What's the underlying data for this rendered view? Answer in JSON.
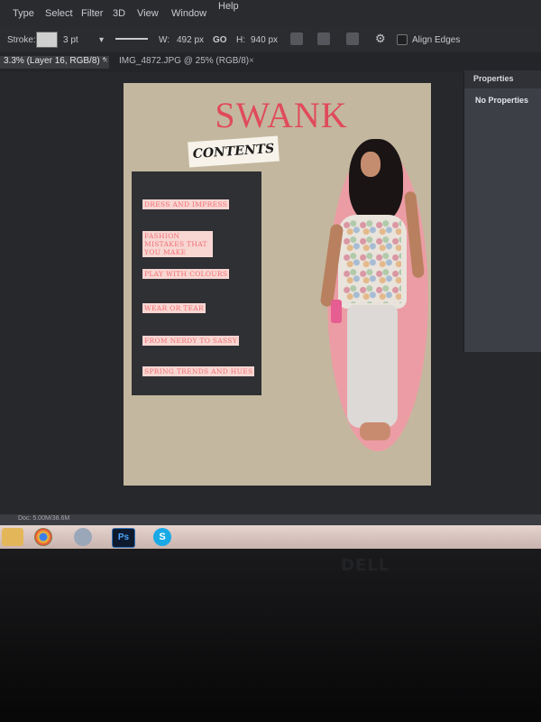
{
  "menubar": {
    "items": [
      "Type",
      "Select",
      "Filter",
      "3D",
      "View",
      "Window",
      "Help"
    ]
  },
  "options": {
    "stroke_label": "Stroke:",
    "stroke_width": "3 pt",
    "w_label": "W:",
    "w_value": "492 px",
    "link_label": "GO",
    "h_label": "H:",
    "h_value": "940 px",
    "align_edges": "Align Edges"
  },
  "doc_tabs": [
    {
      "label": "3.3% (Layer 16, RGB/8) *"
    },
    {
      "label": "IMG_4872.JPG @ 25% (RGB/8)"
    }
  ],
  "properties": {
    "title": "Properties",
    "body": "No Properties"
  },
  "canvas": {
    "title": "SWANK",
    "contents_label": "CONTENTS",
    "toc": [
      "Dress and Impress",
      "Fashion Mistakes that you Make",
      "Play with Colours",
      "Wear or Tear",
      "From Nerdy to Sassy",
      "Spring Trends and Hues"
    ]
  },
  "status": {
    "doc_info": "Doc: 5.00M/38.6M"
  },
  "taskbar": {
    "ps_label": "Ps",
    "skype_label": "S"
  },
  "bezel": {
    "brand": "DELL"
  },
  "colors": {
    "accent_pink": "#e04b5b",
    "ellipse_pink": "#ec9ca4",
    "page_beige": "#c3b89f",
    "toc_panel": "#2f3034"
  }
}
